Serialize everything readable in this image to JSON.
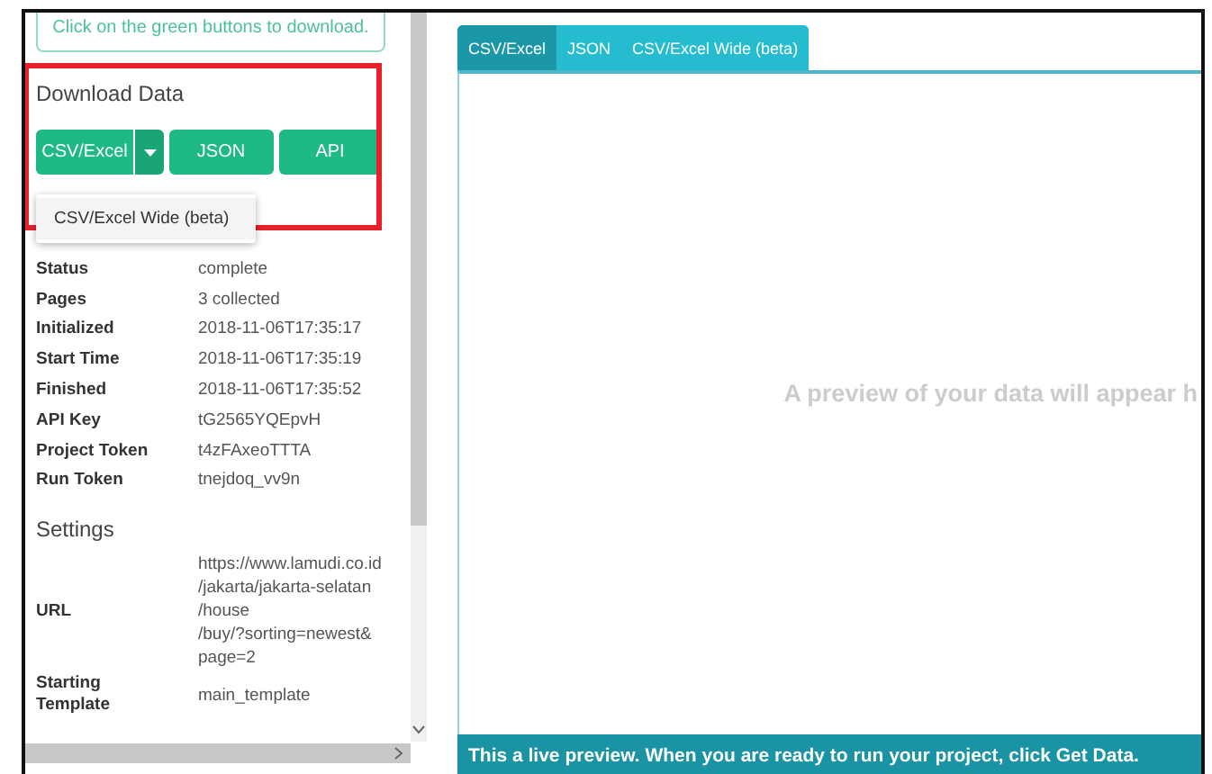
{
  "notice": {
    "text": "Click on the green buttons to download."
  },
  "download": {
    "title": "Download Data",
    "buttons": [
      {
        "label": "CSV/Excel",
        "kind": "split"
      },
      {
        "label": "JSON",
        "kind": "plain"
      },
      {
        "label": "API",
        "kind": "plain"
      }
    ],
    "menu": {
      "expanded": true,
      "items": [
        "CSV/Excel Wide (beta)"
      ]
    }
  },
  "details": [
    {
      "label": "Status",
      "value": "complete"
    },
    {
      "label": "Pages",
      "value": "3 collected"
    },
    {
      "label": "Initialized",
      "value": "2018-11-06T17:35:17"
    },
    {
      "label": "Start Time",
      "value": "2018-11-06T17:35:19"
    },
    {
      "label": "Finished",
      "value": "2018-11-06T17:35:52"
    },
    {
      "label": "API Key",
      "value": "tG2565YQEpvH"
    },
    {
      "label": "Project Token",
      "value": "t4zFAxeoTTTA"
    },
    {
      "label": "Run Token",
      "value": "tnejdoq_vv9n"
    }
  ],
  "settings": {
    "title": "Settings",
    "rows": [
      {
        "label": "URL",
        "value_lines": [
          "https://www.lamudi.co.id",
          "/jakarta/jakarta-selatan",
          "/house",
          "/buy/?sorting=newest&",
          "page=2"
        ]
      },
      {
        "label": "Starting Template",
        "value_lines": [
          "main_template"
        ]
      }
    ]
  },
  "preview": {
    "tabs": [
      {
        "label": "CSV/Excel",
        "selected": true
      },
      {
        "label": "JSON",
        "selected": false
      },
      {
        "label": "CSV/Excel Wide (beta)",
        "selected": false
      }
    ],
    "empty_message": "A preview of your data will appear h",
    "footer": "This a live preview. When you are ready to run your project, click Get Data."
  }
}
